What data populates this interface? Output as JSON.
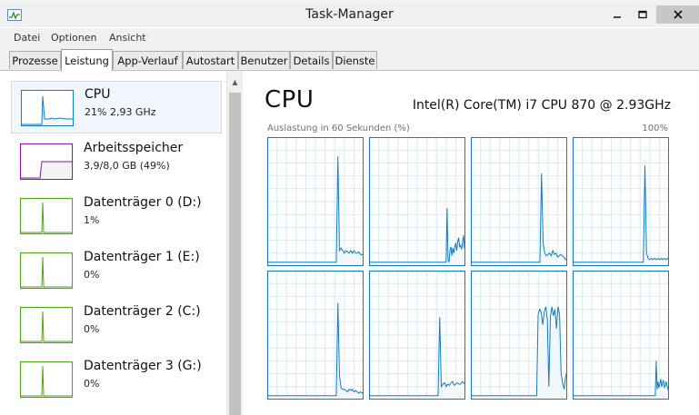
{
  "window": {
    "title": "Task-Manager"
  },
  "menu": [
    "Datei",
    "Optionen",
    "Ansicht"
  ],
  "tabs": [
    "Prozesse",
    "Leistung",
    "App-Verlauf",
    "Autostart",
    "Benutzer",
    "Details",
    "Dienste"
  ],
  "active_tab": "Leistung",
  "resources": [
    {
      "name": "CPU",
      "value": "21% 2,93 GHz",
      "type": "cpu",
      "color": "#117dbb",
      "selected": true
    },
    {
      "name": "Arbeitsspeicher",
      "value": "3,9/8,0 GB (49%)",
      "type": "memory",
      "color": "#8b12ae",
      "selected": false
    },
    {
      "name": "Datenträger 0 (D:)",
      "value": "1%",
      "type": "disk",
      "color": "#4da60c",
      "selected": false
    },
    {
      "name": "Datenträger 1 (E:)",
      "value": "0%",
      "type": "disk",
      "color": "#4da60c",
      "selected": false
    },
    {
      "name": "Datenträger 2 (C:)",
      "value": "0%",
      "type": "disk",
      "color": "#4da60c",
      "selected": false
    },
    {
      "name": "Datenträger 3 (G:)",
      "value": "0%",
      "type": "disk",
      "color": "#4da60c",
      "selected": false
    }
  ],
  "detail": {
    "title": "CPU",
    "model": "Intel(R) Core(TM) i7 CPU 870 @ 2.93GHz",
    "graph_label": "Auslastung in 60 Sekunden (%)",
    "graph_max": "100%"
  },
  "colors": {
    "cpu_line": "#117dbb",
    "cpu_fill": "#f1f6fb",
    "cpu_grid": "#d9eaf4",
    "cpu_border": "#117dbb",
    "selected_bg": "#f0f6fc"
  },
  "chart_data": {
    "type": "line",
    "ylim": [
      0,
      100
    ],
    "x_seconds": 60,
    "series": [
      {
        "values": [
          3,
          3,
          3,
          3,
          3,
          3,
          3,
          3,
          3,
          3,
          3,
          3,
          3,
          3,
          3,
          3,
          3,
          3,
          3,
          3,
          3,
          3,
          3,
          3,
          3,
          3,
          3,
          3,
          3,
          3,
          3,
          3,
          3,
          3,
          3,
          3,
          3,
          3,
          3,
          3,
          3,
          3,
          3,
          3,
          85,
          12,
          14,
          12,
          10,
          12,
          11,
          10,
          12,
          10,
          12,
          10,
          10,
          11,
          9,
          9,
          8
        ]
      },
      {
        "values": [
          3,
          3,
          3,
          3,
          3,
          3,
          3,
          3,
          3,
          3,
          3,
          3,
          3,
          3,
          3,
          3,
          3,
          3,
          3,
          3,
          3,
          3,
          3,
          3,
          3,
          3,
          3,
          3,
          3,
          3,
          3,
          3,
          3,
          3,
          3,
          3,
          3,
          3,
          3,
          3,
          3,
          3,
          3,
          3,
          3,
          3,
          3,
          3,
          3,
          3,
          3,
          3,
          3,
          3,
          3,
          3,
          3,
          3,
          3,
          3,
          3,
          3,
          3,
          3,
          3,
          3,
          3,
          3,
          3,
          3,
          3,
          3,
          3,
          3,
          3,
          3,
          3,
          3,
          3,
          3,
          3,
          45,
          5,
          3,
          12,
          15,
          8,
          14,
          10,
          15,
          18,
          12,
          19,
          22,
          15,
          16,
          13,
          18,
          24,
          14,
          13
        ]
      },
      {
        "values": [
          3,
          3,
          3,
          3,
          3,
          3,
          3,
          3,
          3,
          3,
          3,
          3,
          3,
          3,
          3,
          3,
          3,
          3,
          3,
          3,
          3,
          3,
          3,
          3,
          3,
          3,
          3,
          3,
          3,
          3,
          3,
          3,
          3,
          3,
          3,
          3,
          3,
          3,
          3,
          3,
          3,
          3,
          3,
          3,
          72,
          18,
          10,
          8,
          9,
          10,
          8,
          12,
          9,
          10,
          7,
          8,
          9,
          8,
          7,
          5,
          6
        ]
      },
      {
        "values": [
          3,
          3,
          3,
          3,
          3,
          3,
          3,
          3,
          3,
          3,
          3,
          3,
          3,
          3,
          3,
          3,
          3,
          3,
          3,
          3,
          3,
          3,
          3,
          3,
          3,
          3,
          3,
          3,
          3,
          3,
          3,
          3,
          3,
          3,
          3,
          3,
          3,
          3,
          3,
          3,
          3,
          3,
          3,
          3,
          3,
          78,
          10,
          6,
          5,
          6,
          5,
          6,
          5,
          6,
          5,
          6,
          5,
          6,
          5,
          6,
          5
        ]
      },
      {
        "values": [
          3,
          3,
          3,
          3,
          3,
          3,
          3,
          3,
          3,
          3,
          3,
          3,
          3,
          3,
          3,
          3,
          3,
          3,
          3,
          3,
          3,
          3,
          3,
          3,
          3,
          3,
          3,
          3,
          3,
          3,
          3,
          3,
          3,
          3,
          3,
          3,
          3,
          3,
          3,
          3,
          3,
          3,
          3,
          3,
          75,
          18,
          9,
          8,
          8,
          7,
          6,
          8,
          7,
          8,
          6,
          7,
          6,
          5,
          6,
          5,
          6
        ]
      },
      {
        "values": [
          3,
          3,
          3,
          3,
          3,
          3,
          3,
          3,
          3,
          3,
          3,
          3,
          3,
          3,
          3,
          3,
          3,
          3,
          3,
          3,
          3,
          3,
          3,
          3,
          3,
          3,
          3,
          3,
          3,
          3,
          3,
          3,
          3,
          3,
          3,
          3,
          3,
          3,
          3,
          3,
          3,
          3,
          3,
          3,
          64,
          10,
          12,
          13,
          10,
          12,
          11,
          13,
          14,
          11,
          12,
          13,
          12,
          12,
          14,
          13,
          11
        ]
      },
      {
        "values": [
          3,
          3,
          3,
          3,
          3,
          3,
          3,
          3,
          3,
          3,
          3,
          3,
          3,
          3,
          3,
          3,
          3,
          3,
          3,
          3,
          3,
          3,
          3,
          3,
          3,
          3,
          3,
          3,
          3,
          3,
          3,
          3,
          3,
          3,
          3,
          3,
          3,
          3,
          3,
          3,
          3,
          3,
          3,
          3,
          66,
          70,
          68,
          58,
          68,
          72,
          62,
          10,
          64,
          72,
          65,
          70,
          55,
          72,
          66,
          20,
          13,
          8,
          18,
          22
        ]
      },
      {
        "values": [
          3,
          3,
          3,
          3,
          3,
          3,
          3,
          3,
          3,
          3,
          3,
          3,
          3,
          3,
          3,
          3,
          3,
          3,
          3,
          3,
          3,
          3,
          3,
          3,
          3,
          3,
          3,
          3,
          3,
          3,
          3,
          3,
          3,
          3,
          3,
          3,
          3,
          3,
          3,
          3,
          3,
          3,
          3,
          3,
          3,
          3,
          3,
          3,
          3,
          3,
          3,
          3,
          3,
          3,
          3,
          3,
          3,
          3,
          3,
          3,
          3,
          3,
          3,
          3,
          3,
          3,
          3,
          3,
          3,
          3,
          3,
          3,
          3,
          3,
          3,
          3,
          3,
          3,
          3,
          3,
          3,
          3,
          3,
          3,
          3,
          3,
          3,
          3,
          3,
          3,
          3,
          30,
          8,
          14,
          9,
          12,
          16,
          10,
          13,
          15,
          9,
          11,
          14,
          10,
          8,
          12
        ]
      }
    ]
  }
}
